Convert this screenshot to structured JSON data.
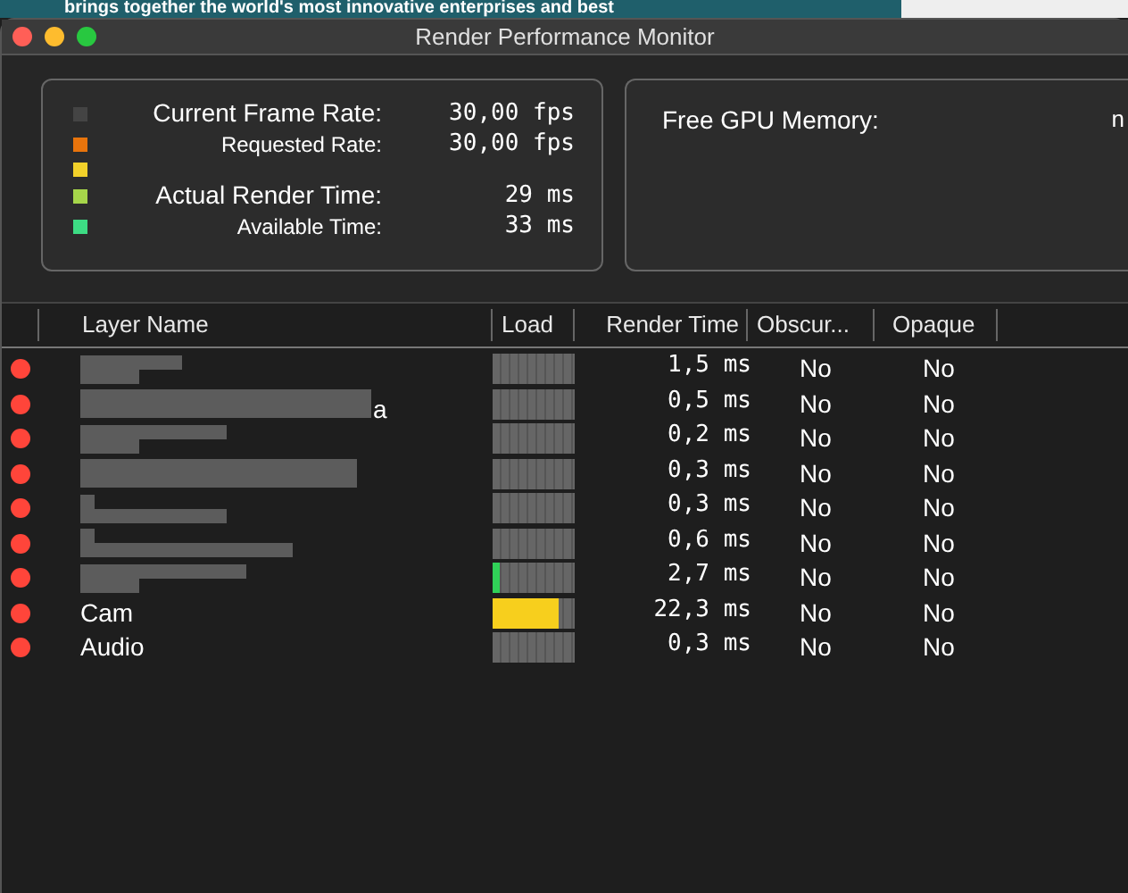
{
  "background_window": {
    "text": "brings together the world's most innovative enterprises and best"
  },
  "window": {
    "title": "Render Performance Monitor"
  },
  "stats_panel": {
    "rows": [
      {
        "color": "#444444",
        "label": "Current Frame Rate:",
        "value": "30,00 fps",
        "kind": "major"
      },
      {
        "color": "#e8740c",
        "label": "Requested Rate:",
        "value": "30,00 fps",
        "kind": "minor"
      },
      {
        "color": "#f2d12a",
        "kind": "spacer"
      },
      {
        "color": "#a6d64a",
        "label": "Actual Render Time:",
        "value": "29 ms",
        "kind": "major"
      },
      {
        "color": "#3ddc84",
        "label": "Available Time:",
        "value": "33 ms",
        "kind": "minor"
      }
    ]
  },
  "gpu_panel": {
    "label": "Free GPU Memory:",
    "value": "n"
  },
  "table": {
    "columns": [
      "Layer Name",
      "Load",
      "Render Time",
      "Obscur...",
      "Opaque"
    ],
    "rows": [
      {
        "kind": "redacted",
        "render_time": "1,5 ms",
        "obscured": "No",
        "opaque": "No"
      },
      {
        "kind": "redacted",
        "name": "a",
        "render_time": "0,5 ms",
        "obscured": "No",
        "opaque": "No"
      },
      {
        "kind": "redacted",
        "render_time": "0,2 ms",
        "obscured": "No",
        "opaque": "No"
      },
      {
        "kind": "redacted",
        "render_time": "0,3 ms",
        "obscured": "No",
        "opaque": "No"
      },
      {
        "kind": "redacted",
        "render_time": "0,3 ms",
        "obscured": "No",
        "opaque": "No"
      },
      {
        "kind": "redacted",
        "render_time": "0,6 ms",
        "obscured": "No",
        "opaque": "No"
      },
      {
        "kind": "redacted",
        "level": 0.08,
        "render_time": "2,7 ms",
        "obscured": "No",
        "opaque": "No"
      },
      {
        "kind": "text",
        "name": "Cam",
        "level": 0.8,
        "render_time": "22,3 ms",
        "obscured": "No",
        "opaque": "No"
      },
      {
        "kind": "text",
        "name": "Audio",
        "render_time": "0,3 ms",
        "obscured": "No",
        "opaque": "No"
      }
    ]
  }
}
